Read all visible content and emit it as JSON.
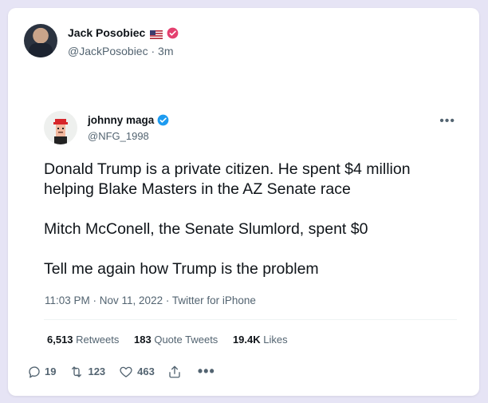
{
  "author": {
    "name": "Jack Posobiec",
    "handle": "@JackPosobiec",
    "time": "3m"
  },
  "quote": {
    "name": "johnny maga",
    "handle": "@NFG_1998",
    "paragraphs": [
      "Donald Trump is a private citizen. He spent $4 million helping Blake Masters in the AZ Senate race",
      "Mitch McConell, the Senate Slumlord, spent $0",
      "Tell me again how Trump is the problem"
    ],
    "meta": "11:03 PM · Nov 11, 2022 · Twitter for iPhone",
    "stats": {
      "retweets_count": "6,513",
      "retweets_label": "Retweets",
      "quotes_count": "183",
      "quotes_label": "Quote Tweets",
      "likes_count": "19.4K",
      "likes_label": "Likes"
    }
  },
  "actions": {
    "replies": "19",
    "retweets": "123",
    "likes": "463"
  },
  "colors": {
    "background": "#e6e4f5",
    "text": "#0f1419",
    "muted": "#536471",
    "verified_blue": "#1d9bf0",
    "verified_pink": "#e4406f"
  }
}
